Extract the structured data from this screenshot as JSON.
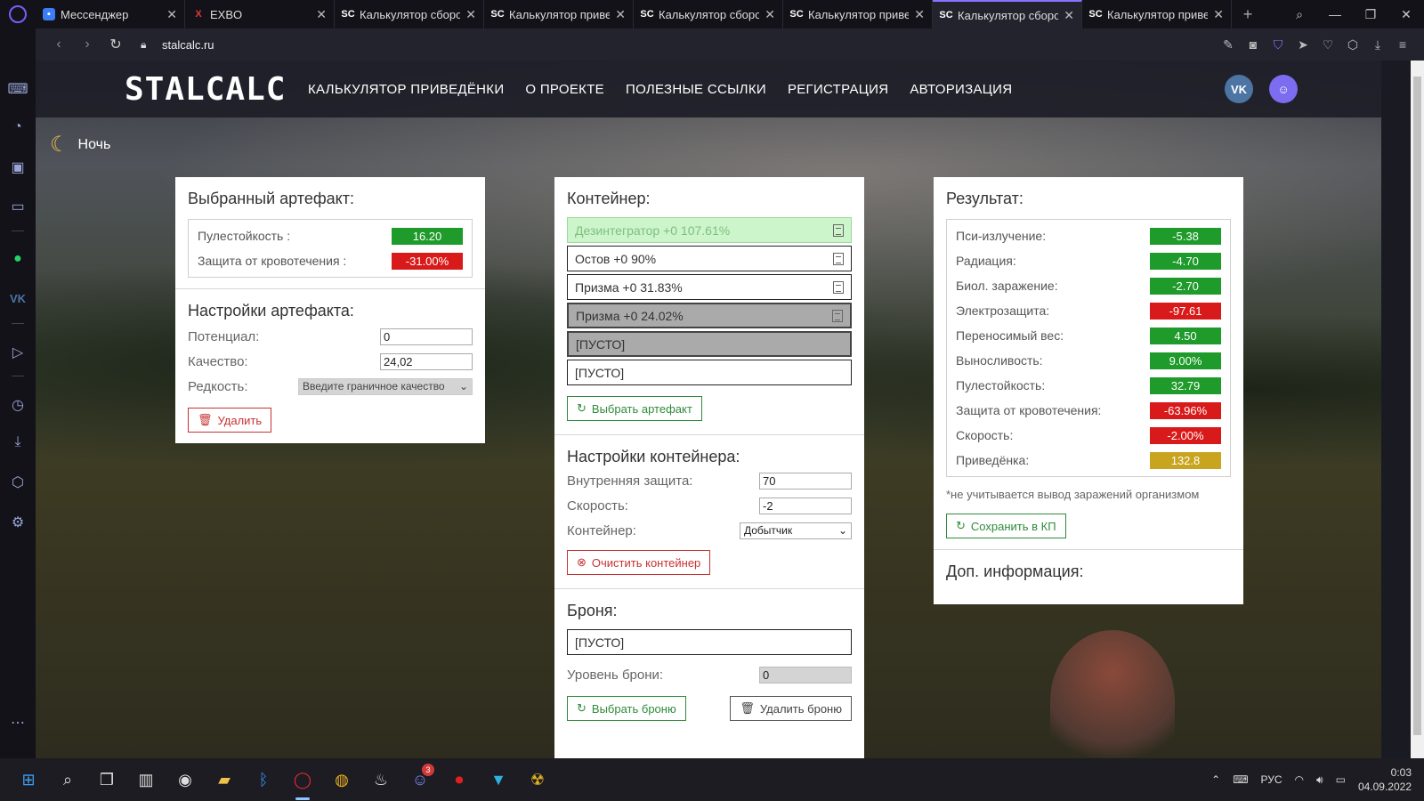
{
  "browser": {
    "tabs": [
      {
        "title": "Мессенджер",
        "favicon": "messenger-icon",
        "active": false
      },
      {
        "title": "EXBO",
        "favicon": "exbo-icon",
        "active": false
      },
      {
        "title": "Калькулятор сборок",
        "favicon": "sc-icon",
        "active": false
      },
      {
        "title": "Калькулятор привед",
        "favicon": "sc-icon",
        "active": false
      },
      {
        "title": "Калькулятор сборок",
        "favicon": "sc-icon",
        "active": false
      },
      {
        "title": "Калькулятор привед",
        "favicon": "sc-icon",
        "active": false
      },
      {
        "title": "Калькулятор сборок",
        "favicon": "sc-icon",
        "active": true
      },
      {
        "title": "Калькулятор привед",
        "favicon": "sc-icon",
        "active": false
      }
    ],
    "url": "stalcalc.ru",
    "accent_color": "#8a70ff"
  },
  "header": {
    "logo": "STALCALC",
    "menu": [
      "КАЛЬКУЛЯТОР ПРИВЕДЁНКИ",
      "О ПРОЕКТЕ",
      "ПОЛЕЗНЫЕ ССЫЛКИ",
      "РЕГИСТРАЦИЯ",
      "АВТОРИЗАЦИЯ"
    ],
    "social_vk": "VK",
    "social_discord": "discord-icon"
  },
  "theme_toggle": "Ночь",
  "artifact": {
    "title": "Выбранный артефакт:",
    "stats": [
      {
        "label": "Пулестойкость :",
        "value": "16.20",
        "color": "green"
      },
      {
        "label": "Защита от кровотечения :",
        "value": "-31.00%",
        "color": "red"
      }
    ],
    "settings_title": "Настройки артефакта:",
    "potential_label": "Потенциал:",
    "potential_value": "0",
    "quality_label": "Качество:",
    "quality_value": "24,02",
    "rarity_label": "Редкость:",
    "rarity_value": "Введите граничное качество",
    "delete_label": "Удалить"
  },
  "container": {
    "title": "Контейнер:",
    "slots": [
      {
        "text": "Дезинтегратор +0 107.61%",
        "state": "highlight",
        "doc": true
      },
      {
        "text": "Остов +0 90%",
        "state": "normal",
        "doc": true
      },
      {
        "text": "Призма +0 31.83%",
        "state": "normal",
        "doc": true
      },
      {
        "text": "Призма +0 24.02%",
        "state": "selected",
        "doc": true
      },
      {
        "text": "[ПУСТО]",
        "state": "selected",
        "doc": false
      },
      {
        "text": "[ПУСТО]",
        "state": "normal",
        "doc": false
      }
    ],
    "choose_label": "Выбрать артефакт",
    "settings_title": "Настройки контейнера:",
    "inner_protection_label": "Внутренняя защита:",
    "inner_protection_value": "70",
    "speed_label": "Скорость:",
    "speed_value": "-2",
    "container_label": "Контейнер:",
    "container_value": "Добытчик",
    "clear_label": "Очистить контейнер"
  },
  "armor": {
    "title": "Броня:",
    "slot": "[ПУСТО]",
    "level_label": "Уровень брони:",
    "level_value": "0",
    "choose_label": "Выбрать броню",
    "delete_label": "Удалить броню"
  },
  "result": {
    "title": "Результат:",
    "stats": [
      {
        "label": "Пси-излучение:",
        "value": "-5.38",
        "color": "green"
      },
      {
        "label": "Радиация:",
        "value": "-4.70",
        "color": "green"
      },
      {
        "label": "Биол. заражение:",
        "value": "-2.70",
        "color": "green"
      },
      {
        "label": "Электрозащита:",
        "value": "-97.61",
        "color": "red"
      },
      {
        "label": "Переносимый вес:",
        "value": "4.50",
        "color": "green"
      },
      {
        "label": "Выносливость:",
        "value": "9.00%",
        "color": "green"
      },
      {
        "label": "Пулестойкость:",
        "value": "32.79",
        "color": "green"
      },
      {
        "label": "Защита от кровотечения:",
        "value": "-63.96%",
        "color": "red"
      },
      {
        "label": "Скорость:",
        "value": "-2.00%",
        "color": "red"
      },
      {
        "label": "Приведёнка:",
        "value": "132.8",
        "color": "gold"
      }
    ],
    "note": "*не учитывается вывод заражений организмом",
    "save_label": "Сохранить в КП",
    "extra_title": "Доп. информация:"
  },
  "taskbar": {
    "discord_badge": "3",
    "lang": "РУС",
    "time": "0:03",
    "date": "04.09.2022"
  }
}
